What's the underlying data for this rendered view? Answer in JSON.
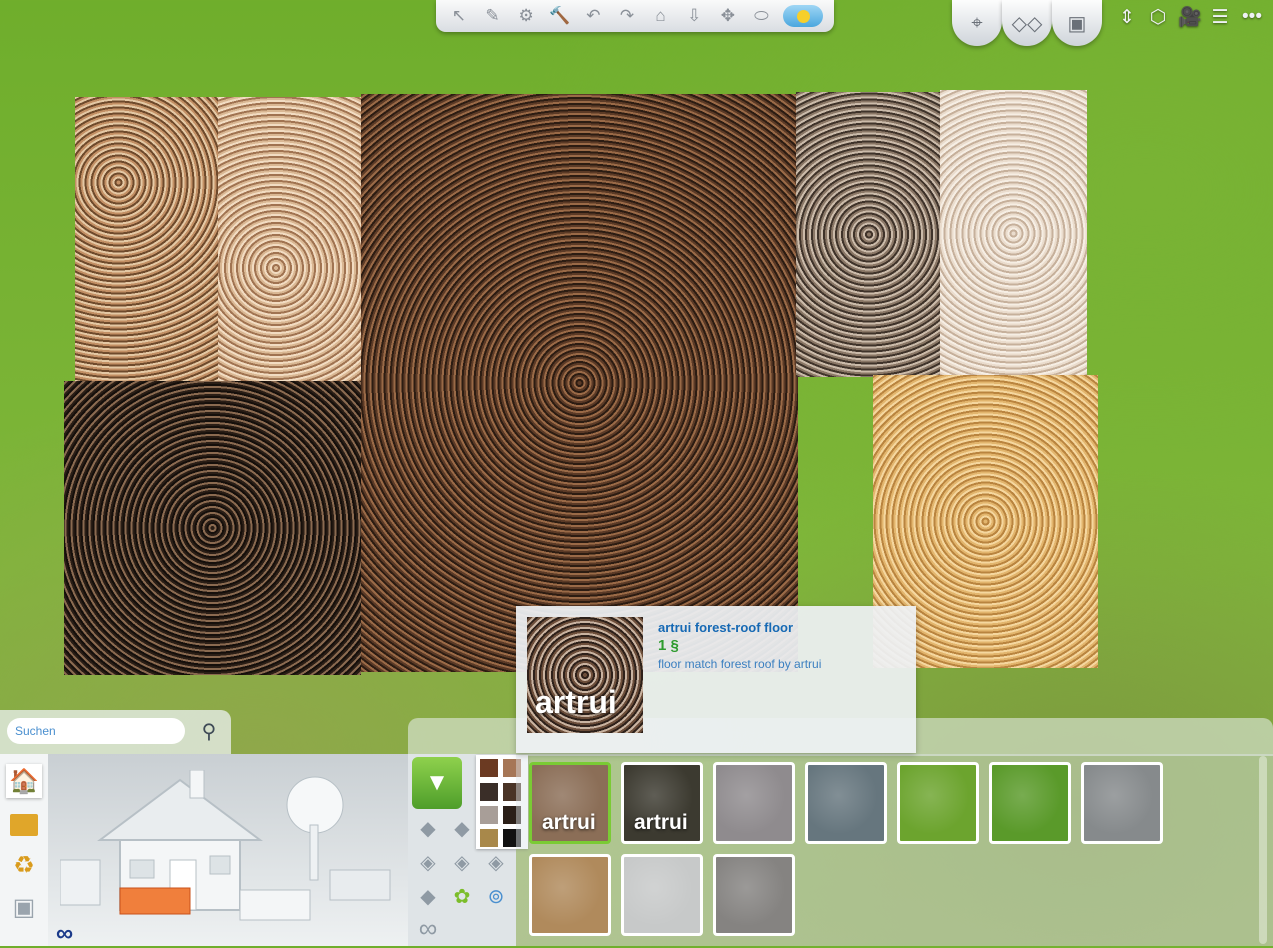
{
  "toolbar": {
    "icons": [
      "select-icon",
      "eyedropper-icon",
      "design-tool-icon",
      "sledgehammer-icon",
      "undo-icon",
      "redo-icon",
      "house-icon",
      "floor-level-icon",
      "move-icon",
      "camera-icon",
      "sun-icon"
    ],
    "glyphs": [
      "↖",
      "✎",
      "⚙",
      "🔨",
      "↶",
      "↷",
      "⌂",
      "⇩",
      "✥",
      "⬭",
      ""
    ]
  },
  "top_right": {
    "glyphs": [
      "⌖",
      "◇◇",
      "▣",
      "⇕",
      "⬡",
      "🎥",
      "☰",
      "•••"
    ]
  },
  "tooltip": {
    "thumb_label": "artrui",
    "title": "artrui forest-roof floor",
    "price": "1 §",
    "description": "floor match forest roof by artrui"
  },
  "search": {
    "placeholder": "Suchen"
  },
  "left_panel": {
    "infinity": "∞"
  },
  "modes": {
    "more_symbol": "∞"
  },
  "swatches": [
    "#6b3a22",
    "#a67656",
    "#3a2e28",
    "#4a3426",
    "#a89e98",
    "#2b1f18",
    "#a8884a",
    "#111111"
  ],
  "items": [
    {
      "label": "artrui",
      "color": "#8b6e57",
      "selected": true
    },
    {
      "label": "artrui",
      "color": "#3c3a30",
      "selected": false
    },
    {
      "label": "",
      "color": "#8f8b8e",
      "selected": false
    },
    {
      "label": "",
      "color": "#66767e",
      "selected": false
    },
    {
      "label": "",
      "color": "#6ca42e",
      "selected": false
    },
    {
      "label": "",
      "color": "#5a9a2a",
      "selected": false
    },
    {
      "label": "",
      "color": "#868a8c",
      "selected": false
    },
    {
      "label": "",
      "color": "#b08a5c",
      "selected": false
    },
    {
      "label": "",
      "color": "#c7c9c9",
      "selected": false
    },
    {
      "label": "",
      "color": "#858381",
      "selected": false
    }
  ]
}
